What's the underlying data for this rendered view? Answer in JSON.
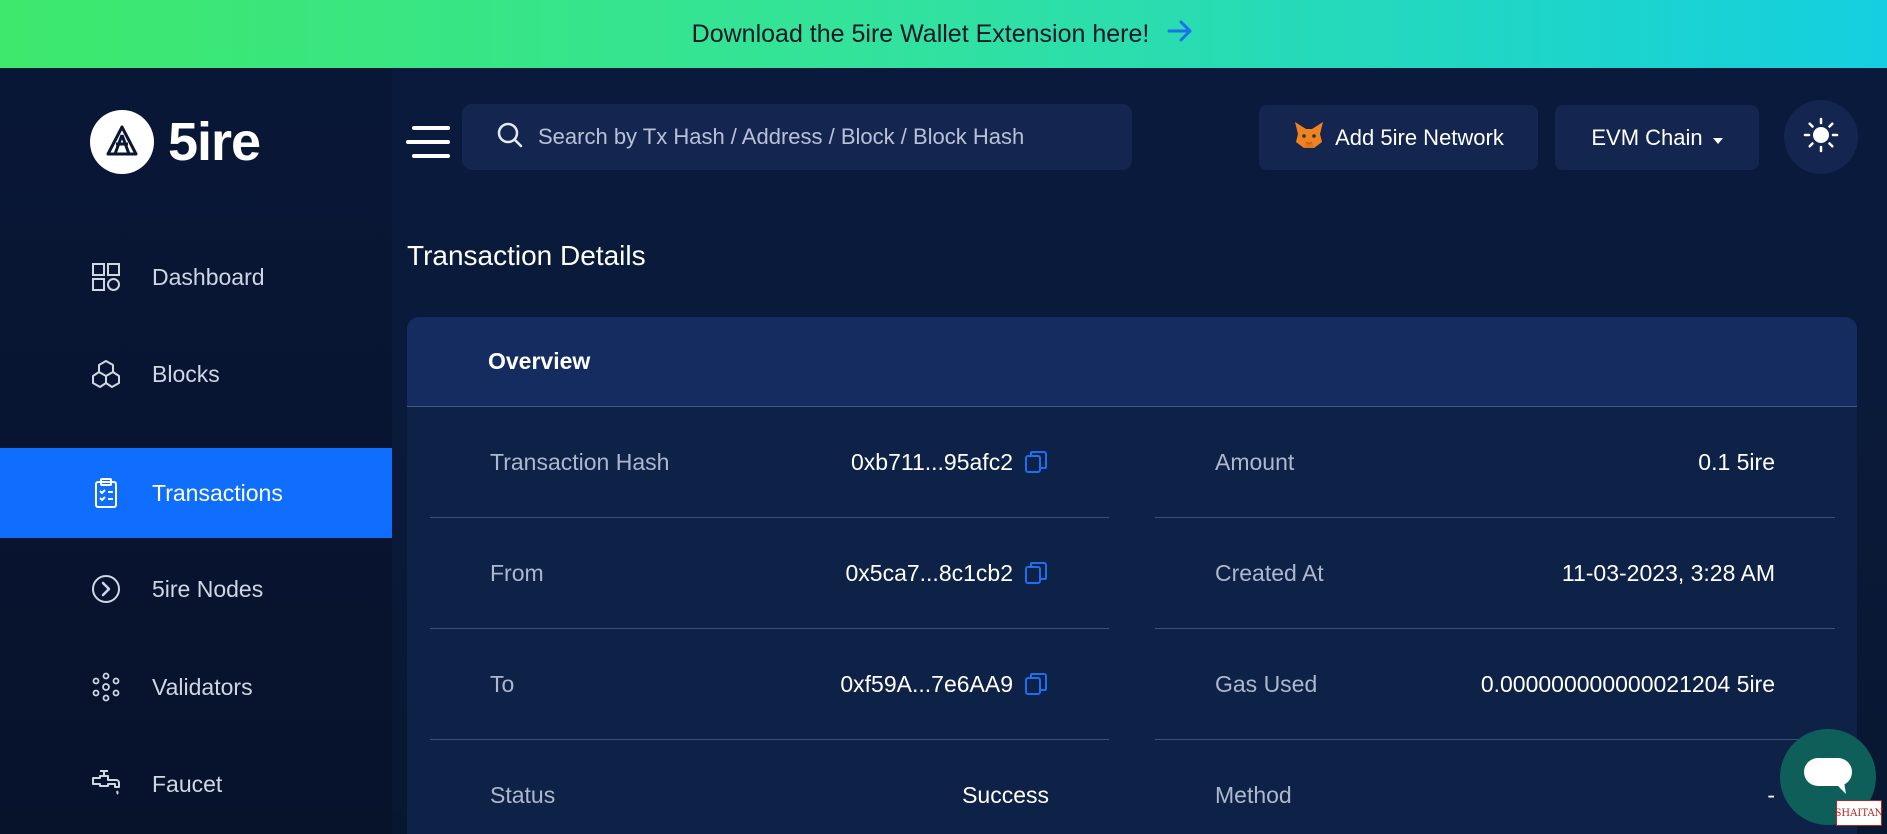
{
  "banner": {
    "text": "Download the 5ire Wallet Extension here!",
    "icon": "arrow-right-icon"
  },
  "brand": {
    "name": "5ire"
  },
  "sidebar": {
    "items": [
      {
        "label": "Dashboard",
        "icon": "dashboard-grid-icon",
        "active": false
      },
      {
        "label": "Blocks",
        "icon": "blocks-cubes-icon",
        "active": false
      },
      {
        "label": "Transactions",
        "icon": "clipboard-list-icon",
        "active": true
      },
      {
        "label": "5ire Nodes",
        "icon": "chevron-circle-icon",
        "active": false
      },
      {
        "label": "Validators",
        "icon": "network-nodes-icon",
        "active": false
      },
      {
        "label": "Faucet",
        "icon": "faucet-tap-icon",
        "active": false
      }
    ]
  },
  "search": {
    "placeholder": "Search by Tx Hash / Address / Block / Block Hash",
    "value": ""
  },
  "header": {
    "add_network_label": "Add 5ire Network",
    "chain_label": "EVM Chain"
  },
  "page": {
    "title": "Transaction Details"
  },
  "overview": {
    "title": "Overview",
    "left": [
      {
        "label": "Transaction Hash",
        "value": "0xb711...95afc2",
        "copyable": true
      },
      {
        "label": "From",
        "value": "0x5ca7...8c1cb2",
        "copyable": true
      },
      {
        "label": "To",
        "value": "0xf59A...7e6AA9",
        "copyable": true
      },
      {
        "label": "Status",
        "value": "Success",
        "copyable": false
      }
    ],
    "right": [
      {
        "label": "Amount",
        "value": "0.1 5ire"
      },
      {
        "label": "Created At",
        "value": "11-03-2023, 3:28 AM"
      },
      {
        "label": "Gas Used",
        "value": "0.000000000000021204 5ire"
      },
      {
        "label": "Method",
        "value": "-"
      }
    ]
  },
  "watermark": {
    "text": "SHAITAN"
  },
  "colors": {
    "accent": "#0f6efd",
    "background": "#081530",
    "card": "#0e2147",
    "banner_start": "#3ee86c",
    "banner_end": "#14cfe0"
  }
}
